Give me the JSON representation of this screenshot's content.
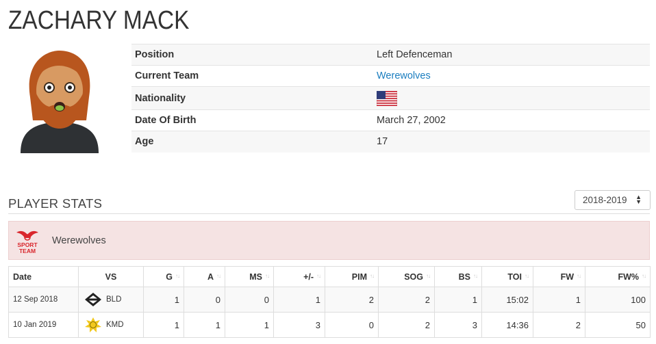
{
  "player": {
    "name": "ZACHARY MACK"
  },
  "info": {
    "rows": [
      {
        "label": "Position",
        "value": "Left Defenceman"
      },
      {
        "label": "Current Team",
        "value": "Werewolves"
      },
      {
        "label": "Nationality",
        "value": "",
        "icon": "us-flag-icon"
      },
      {
        "label": "Date Of Birth",
        "value": "March 27, 2002"
      },
      {
        "label": "Age",
        "value": "17"
      }
    ]
  },
  "stats": {
    "title": "PLAYER STATS",
    "season": "2018-2019",
    "team": {
      "name": "Werewolves",
      "logo_text": [
        "SPORT",
        "TEAM"
      ]
    },
    "columns": [
      "Date",
      "VS",
      "G",
      "A",
      "MS",
      "+/-",
      "PIM",
      "SOG",
      "BS",
      "TOI",
      "FW",
      "FW%"
    ],
    "rows": [
      {
        "date": "12 Sep 2018",
        "vs": "BLD",
        "g": "1",
        "a": "0",
        "ms": "0",
        "pm": "1",
        "pim": "2",
        "sog": "2",
        "bs": "1",
        "toi": "15:02",
        "fw": "1",
        "fwp": "100"
      },
      {
        "date": "10 Jan 2019",
        "vs": "KMD",
        "g": "1",
        "a": "1",
        "ms": "1",
        "pm": "3",
        "pim": "0",
        "sog": "2",
        "bs": "3",
        "toi": "14:36",
        "fw": "2",
        "fwp": "50"
      }
    ]
  },
  "colors": {
    "link": "#1a7dbf",
    "banner_bg": "#f5e3e3",
    "logo_red": "#d9262c"
  }
}
